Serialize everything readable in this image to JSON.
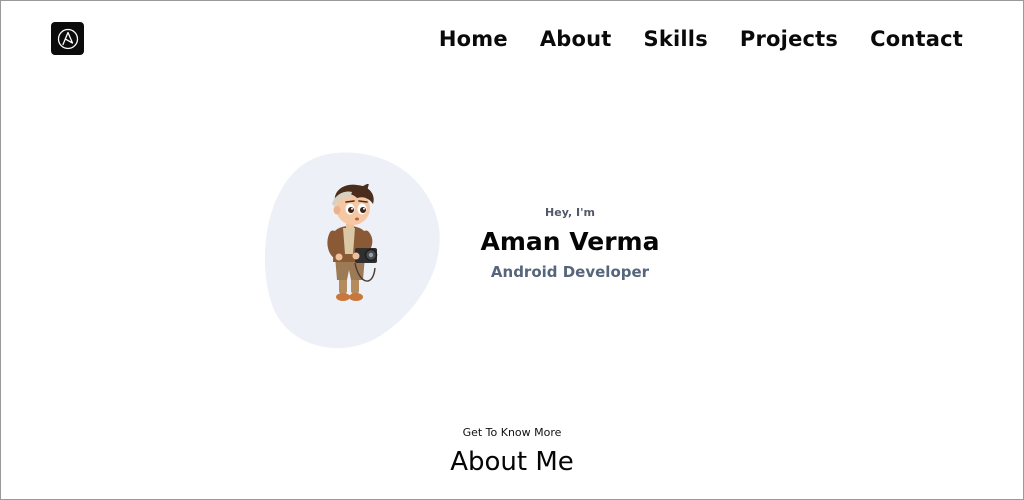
{
  "header": {
    "logo": {
      "icon": "a-triangle-logo-icon"
    },
    "nav": [
      {
        "label": "Home"
      },
      {
        "label": "About"
      },
      {
        "label": "Skills"
      },
      {
        "label": "Projects"
      },
      {
        "label": "Contact"
      }
    ]
  },
  "hero": {
    "greeting": "Hey, I'm",
    "name": "Aman Verma",
    "role": "Android Developer",
    "blob_color": "#eef0f7"
  },
  "about": {
    "subtitle": "Get To Know More",
    "title": "About Me"
  }
}
